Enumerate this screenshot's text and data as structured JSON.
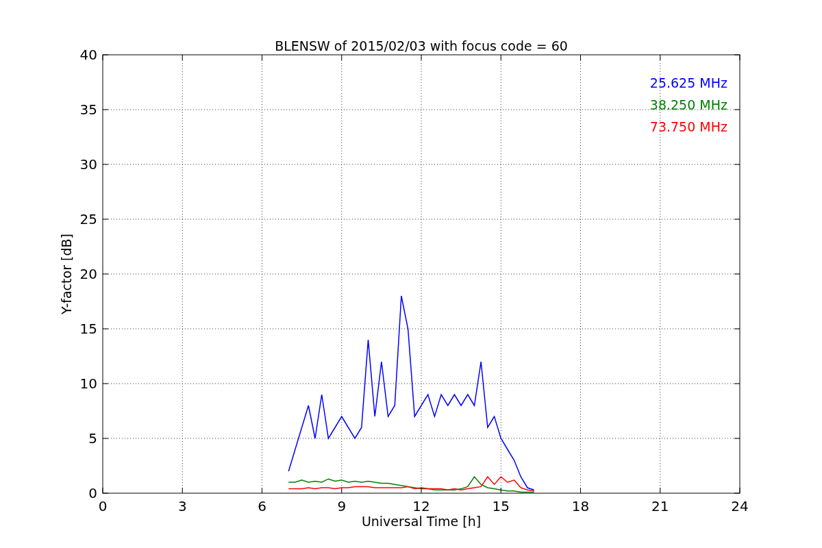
{
  "chart_data": {
    "type": "line",
    "title": "BLENSW of 2015/02/03 with focus code = 60",
    "xlabel": "Universal Time [h]",
    "ylabel": "Y-factor [dB]",
    "x": [
      7,
      7.25,
      7.5,
      7.75,
      8,
      8.25,
      8.5,
      8.75,
      9,
      9.25,
      9.5,
      9.75,
      10,
      10.25,
      10.5,
      10.75,
      11,
      11.25,
      11.5,
      11.75,
      12,
      12.25,
      12.5,
      12.75,
      13,
      13.25,
      13.5,
      13.75,
      14,
      14.25,
      14.5,
      14.75,
      15,
      15.25,
      15.5,
      15.75,
      16,
      16.25
    ],
    "series": [
      {
        "name": "25.625 MHz",
        "color": "#0000ff",
        "values": [
          2,
          4,
          6,
          8,
          5,
          9,
          5,
          6,
          7,
          6,
          5,
          6,
          14,
          7,
          12,
          7,
          8,
          18,
          15,
          7,
          8,
          9,
          7,
          9,
          8,
          9,
          8,
          9,
          8,
          12,
          6,
          7,
          5,
          4,
          3,
          1.5,
          0.5,
          0.3
        ]
      },
      {
        "name": "38.250 MHz",
        "color": "#008000",
        "values": [
          1,
          1,
          1.2,
          1,
          1.1,
          1,
          1.3,
          1.1,
          1.2,
          1,
          1.1,
          1,
          1.1,
          1,
          0.9,
          0.9,
          0.8,
          0.7,
          0.6,
          0.5,
          0.4,
          0.4,
          0.3,
          0.3,
          0.3,
          0.3,
          0.4,
          0.6,
          1.5,
          0.8,
          0.5,
          0.4,
          0.3,
          0.2,
          0.2,
          0.1,
          0.1,
          0.1
        ]
      },
      {
        "name": "73.750 MHz",
        "color": "#ff0000",
        "values": [
          0.4,
          0.4,
          0.4,
          0.5,
          0.4,
          0.5,
          0.5,
          0.4,
          0.5,
          0.5,
          0.6,
          0.6,
          0.6,
          0.5,
          0.5,
          0.5,
          0.5,
          0.5,
          0.6,
          0.4,
          0.5,
          0.4,
          0.4,
          0.4,
          0.3,
          0.4,
          0.3,
          0.4,
          0.5,
          0.6,
          1.5,
          0.8,
          1.5,
          1,
          1.2,
          0.5,
          0.3,
          0.2
        ]
      }
    ],
    "xlim": [
      0,
      24
    ],
    "ylim": [
      0,
      40
    ],
    "xticks": [
      0,
      3,
      6,
      9,
      12,
      15,
      18,
      21,
      24
    ],
    "yticks": [
      0,
      5,
      10,
      15,
      20,
      25,
      30,
      35,
      40
    ],
    "grid": true
  }
}
